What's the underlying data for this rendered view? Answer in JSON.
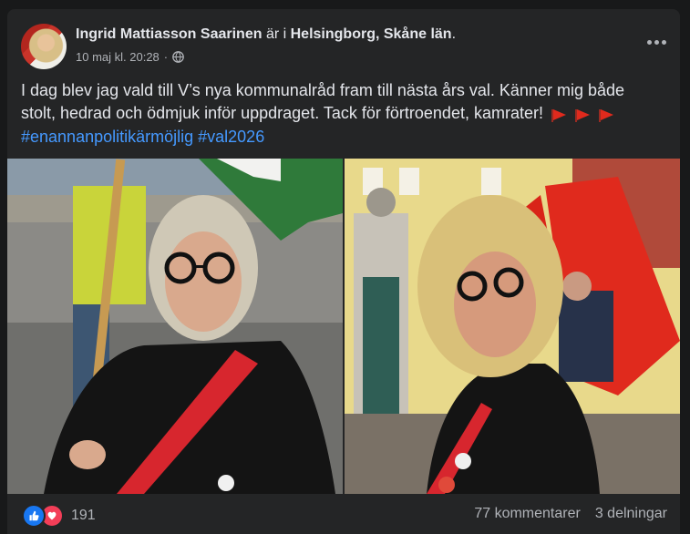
{
  "post": {
    "author": "Ingrid Mattiasson Saarinen",
    "is_at_text": "är i",
    "location": "Helsingborg, Skåne län",
    "location_period": ".",
    "timestamp": "10 maj kl. 20:28",
    "separator": "·",
    "privacy_icon": "globe-icon",
    "text_line1": "I dag blev jag vald till V’s nya kommunalråd fram till nästa års val. Känner mig både",
    "text_line2": "stolt, hedrad och ödmjuk inför uppdraget. Tack för förtroendet, kamrater!",
    "hashtags": [
      "#enannanpolitikärmöjlig",
      "#val2026"
    ]
  },
  "footer": {
    "reaction_icons": [
      "like-icon",
      "love-icon"
    ],
    "reaction_count": "191",
    "comments": "77 kommentarer",
    "shares": "3 delningar"
  },
  "colors": {
    "background": "#18191a",
    "card": "#242526",
    "text_primary": "#e4e6eb",
    "text_secondary": "#b0b3b8",
    "link": "#4599ff",
    "like": "#1877f2",
    "love": "#f33e58"
  }
}
